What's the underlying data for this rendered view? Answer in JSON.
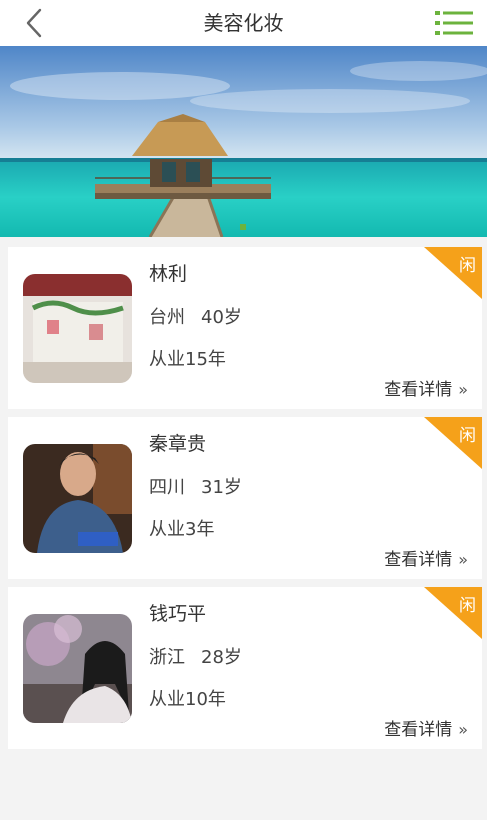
{
  "header": {
    "title": "美容化妆",
    "back_icon": "back-chevron-icon",
    "menu_icon": "list-menu-icon",
    "accent_color": "#6cb33e"
  },
  "banner": {
    "image": "tropical-pier-hut-photo",
    "active_dot_color": "#6cb33e"
  },
  "badge_color": "#f5a11a",
  "workers": [
    {
      "name": "林利",
      "location": "台州",
      "age": "40岁",
      "experience": "从业15年",
      "status": "闲",
      "detail_label": "查看详情",
      "detail_arrow": "»",
      "photo": "beauty-salon-photo"
    },
    {
      "name": "秦章贵",
      "location": "四川",
      "age": "31岁",
      "experience": "从业3年",
      "status": "闲",
      "detail_label": "查看详情",
      "detail_arrow": "»",
      "photo": "man-working-photo"
    },
    {
      "name": "钱巧平",
      "location": "浙江",
      "age": "28岁",
      "experience": "从业10年",
      "status": "闲",
      "detail_label": "查看详情",
      "detail_arrow": "»",
      "photo": "woman-portrait-photo"
    }
  ]
}
